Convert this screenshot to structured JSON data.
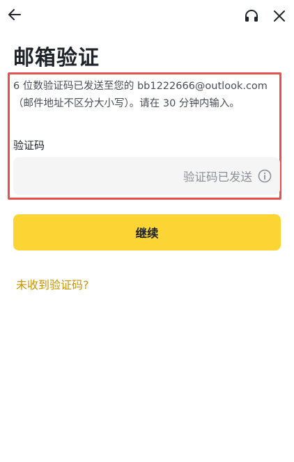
{
  "header": {
    "back_icon": "arrow-left-icon",
    "support_icon": "headset-icon",
    "close_icon": "close-icon"
  },
  "page": {
    "title": "邮箱验证"
  },
  "description": {
    "line1": "6 位数验证码已发送至您的 bb1222666@outlook.com",
    "line2": "（邮件地址不区分大小写）。请在 30 分钟内输入。"
  },
  "code_field": {
    "label": "验证码",
    "value": "",
    "status_text": "验证码已发送",
    "status_icon": "info-circle-icon"
  },
  "actions": {
    "continue_label": "继续",
    "resend_link": "未收到验证码?"
  },
  "colors": {
    "accent": "#fcd535",
    "link": "#c99400",
    "highlight_border": "#e8504f",
    "input_bg": "#f5f5f5"
  }
}
